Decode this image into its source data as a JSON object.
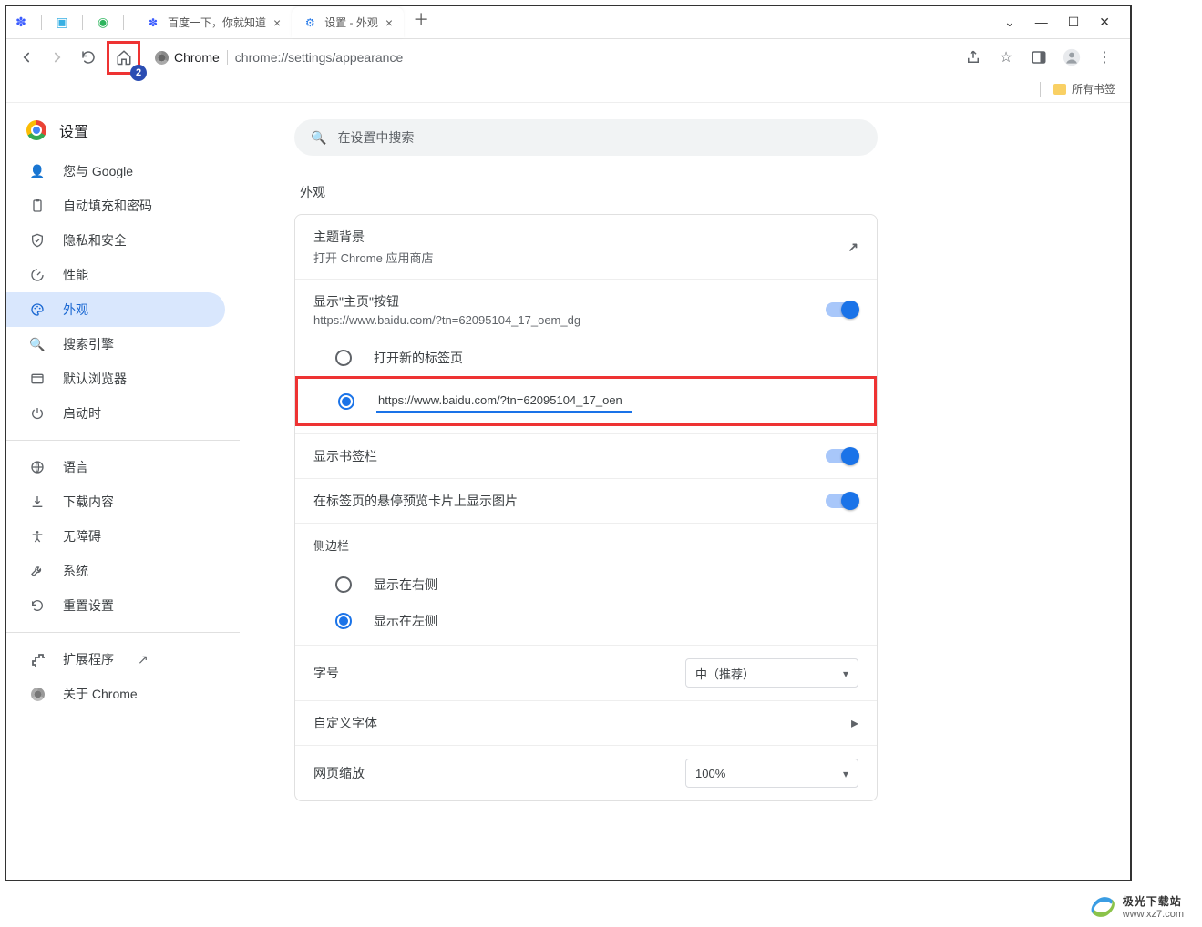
{
  "titlebar": {
    "tab1": {
      "title": "百度一下，你就知道"
    },
    "tab2": {
      "title": "设置 - 外观"
    }
  },
  "address": {
    "chip": "Chrome",
    "url": "chrome://settings/appearance"
  },
  "bookmarks": {
    "all": "所有书签"
  },
  "sidebar": {
    "title": "设置",
    "items": {
      "you_google": "您与 Google",
      "autofill": "自动填充和密码",
      "privacy": "隐私和安全",
      "performance": "性能",
      "appearance": "外观",
      "search": "搜索引擎",
      "browser": "默认浏览器",
      "startup": "启动时",
      "language": "语言",
      "downloads": "下载内容",
      "accessibility": "无障碍",
      "system": "系统",
      "reset": "重置设置",
      "extensions": "扩展程序",
      "about": "关于 Chrome"
    }
  },
  "main": {
    "search_placeholder": "在设置中搜索",
    "section": "外观",
    "theme": {
      "title": "主题背景",
      "sub": "打开 Chrome 应用商店"
    },
    "homebtn": {
      "title": "显示\"主页\"按钮",
      "sub": "https://www.baidu.com/?tn=62095104_17_oem_dg"
    },
    "home_radio1": "打开新的标签页",
    "home_url_value": "https://www.baidu.com/?tn=62095104_17_oen",
    "bookmarks_bar": "显示书签栏",
    "hover_cards": "在标签页的悬停预览卡片上显示图片",
    "sidepanel": "侧边栏",
    "side_right": "显示在右侧",
    "side_left": "显示在左侧",
    "fontsize": {
      "label": "字号",
      "value": "中（推荐）"
    },
    "customfont": "自定义字体",
    "zoom": {
      "label": "网页缩放",
      "value": "100%"
    }
  },
  "watermark": {
    "line1": "极光下载站",
    "line2": "www.xz7.com"
  }
}
